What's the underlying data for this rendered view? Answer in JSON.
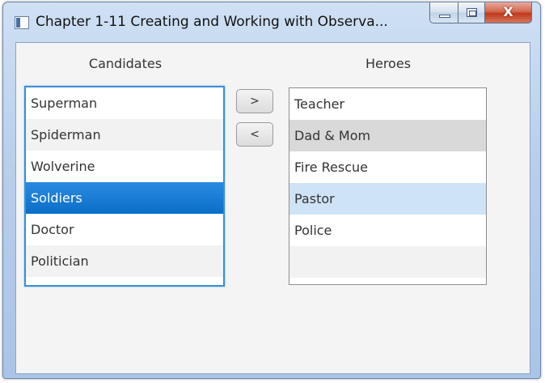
{
  "window": {
    "title": "Chapter 1-11 Creating and Working with Observa...",
    "controls": {
      "minimize": "minimize-icon",
      "maximize": "maximize-icon",
      "close_glyph": "X"
    }
  },
  "candidates": {
    "label": "Candidates",
    "items": [
      "Superman",
      "Spiderman",
      "Wolverine",
      "Soldiers",
      "Doctor",
      "Politician"
    ],
    "selected": "Soldiers"
  },
  "heroes": {
    "label": "Heroes",
    "items": [
      "Teacher",
      "Dad & Mom",
      "Fire Rescue",
      "Pastor",
      "Police"
    ],
    "focused": "Dad & Mom",
    "highlighted": "Pastor"
  },
  "buttons": {
    "move_right": ">",
    "move_left": "<"
  },
  "colors": {
    "selection": "#0a6ec8",
    "focus_border": "#3a8fd6",
    "hover_row": "#cfe3f6",
    "close_button": "#c0391b"
  }
}
